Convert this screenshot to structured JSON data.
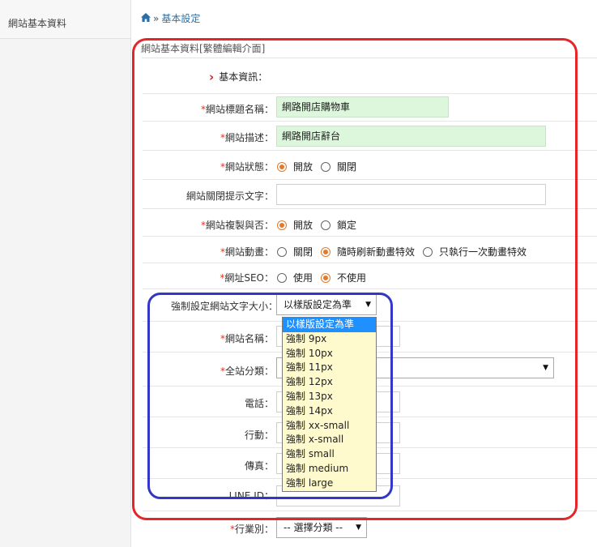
{
  "sidebar": {
    "items": [
      {
        "label": "網站基本資料"
      }
    ]
  },
  "breadcrumb": {
    "home_icon": "home-icon",
    "sep": "»",
    "current": "基本設定"
  },
  "panel": {
    "title": "網站基本資料[繁體編輯介面]"
  },
  "section": {
    "label": "基本資訊："
  },
  "fields": {
    "site_title": {
      "label": "網站標題名稱：",
      "value": "網路開店購物車"
    },
    "site_desc": {
      "label": "網站描述：",
      "value": "網路開店辭台"
    },
    "site_status": {
      "label": "網站狀態：",
      "options": [
        "開放",
        "關閉"
      ],
      "selected": 0
    },
    "close_text": {
      "label": "網站關閉提示文字：",
      "value": ""
    },
    "copyable": {
      "label": "網站複製與否：",
      "options": [
        "開放",
        "鎖定"
      ],
      "selected": 0
    },
    "animation": {
      "label": "網站動畫：",
      "options": [
        "關閉",
        "隨時刷新動畫特效",
        "只執行一次動畫特效"
      ],
      "selected": 1
    },
    "seo_url": {
      "label": "網址SEO：",
      "options": [
        "使用",
        "不使用"
      ],
      "selected": 1
    },
    "font_size": {
      "label": "強制設定網站文字大小：",
      "value": "以樣版設定為準"
    },
    "site_name": {
      "label": "網站名稱："
    },
    "category": {
      "label": "全站分類："
    },
    "phone": {
      "label": "電話："
    },
    "mobile": {
      "label": "行動："
    },
    "fax": {
      "label": "傳真："
    },
    "line_id": {
      "label": "LINE ID："
    },
    "industry": {
      "label": "行業別：",
      "value": "-- 選擇分類 --"
    }
  },
  "required_mark": "*",
  "dropdown": {
    "options": [
      "以樣版設定為準",
      "強制 9px",
      "強制 10px",
      "強制 11px",
      "強制 12px",
      "強制 13px",
      "強制 14px",
      "強制 xx-small",
      "強制 x-small",
      "強制 small",
      "強制 medium",
      "強制 large"
    ],
    "selected_index": 0
  },
  "colors": {
    "accent_radio": "#e07a2c",
    "required": "#e0341d",
    "highlight_red": "#e5252a",
    "highlight_blue": "#3336c7",
    "dropdown_bg": "#fffacd",
    "selected_bg": "#1e90ff"
  }
}
